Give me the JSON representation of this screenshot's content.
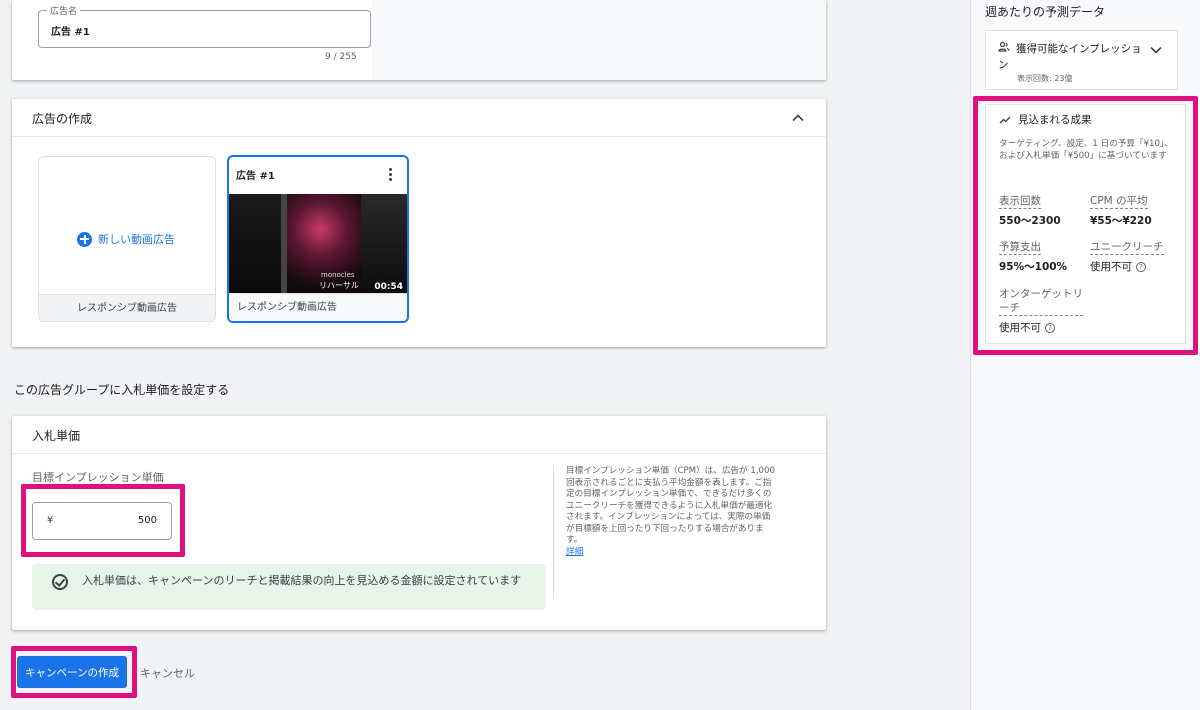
{
  "ad_name": {
    "legend": "広告名",
    "value": "広告 #1",
    "counter": "9 / 255"
  },
  "creation": {
    "title": "広告の作成",
    "new_tile": {
      "button_label": "新しい動画広告",
      "footer": "レスポンシブ動画広告"
    },
    "ad_tile": {
      "title": "広告 #1",
      "thumbnail_caption1": "monocles",
      "thumbnail_caption2": "リハーサル",
      "duration": "00:54",
      "footer": "レスポンシブ動画広告"
    }
  },
  "bid_section": {
    "heading": "この広告グループに入札単価を設定する",
    "card_title": "入札単価",
    "field_label": "目標インプレッション単価",
    "currency": "¥",
    "amount": "500",
    "success_message": "入札単価は、キャンペーンのリーチと掲載結果の向上を見込める金額に設定されています",
    "help_text": "目標インプレッション単価（CPM）は、広告が 1,000 回表示されるごとに支払う平均金額を表します。ご指定の目標インプレッション単価で、できるだけ多くのユニークリーチを獲得できるように入札単価が最適化されます。インプレッションによっては、実際の単価が目標額を上回ったり下回ったりする場合があります。",
    "help_link": "詳細"
  },
  "actions": {
    "create_label": "キャンペーンの作成",
    "cancel_label": "キャンセル"
  },
  "forecast": {
    "title": "週あたりの予測データ",
    "impressions": {
      "title": "獲得可能なインプレッション",
      "subtitle": "表示回数: 23億"
    },
    "results": {
      "title": "見込まれる成果",
      "description": "ターゲティング、設定、1 日の予算「¥10」、および入札単価「¥500」に基づいています",
      "metrics": [
        {
          "label": "表示回数",
          "value": "550〜2300"
        },
        {
          "label": "CPM の平均",
          "value": "¥55〜¥220"
        },
        {
          "label": "予算支出",
          "value": "95%〜100%"
        },
        {
          "label": "ユニークリーチ",
          "value": "使用不可"
        },
        {
          "label": "オンターゲットリーチ",
          "value": "使用不可"
        }
      ]
    }
  },
  "colors": {
    "accent": "#1a73e8",
    "highlight": "#e0107f",
    "success_bg": "#e6f4ea"
  }
}
